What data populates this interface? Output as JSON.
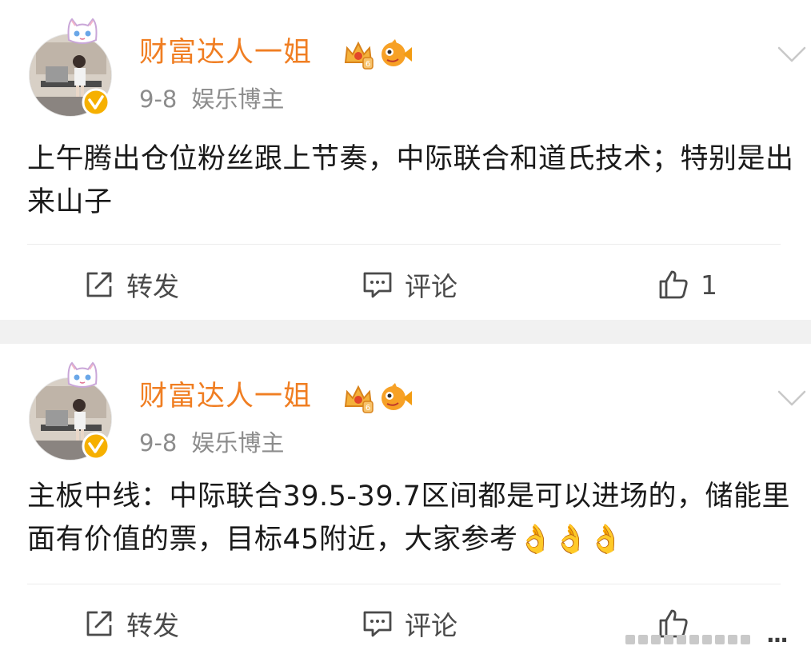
{
  "colors": {
    "username": "#f07e22",
    "meta": "#8c8c8c",
    "text": "#1a1a1a",
    "action": "#4a4a4a",
    "verified": "#f6b000",
    "separator": "#f1f1f1"
  },
  "posts": [
    {
      "author": "财富达人一姐",
      "date": "9-8",
      "source": "娱乐博主",
      "text": "上午腾出仓位粉丝跟上节奏，中际联合和道氏技术；特别是出来山子",
      "actions": {
        "repost": "转发",
        "comment": "评论",
        "like_count": "1"
      },
      "icons": [
        "cat-avatar-frame-icon",
        "verified-badge-icon",
        "crown-level-icon",
        "fish-badge-icon",
        "chevron-down-icon"
      ]
    },
    {
      "author": "财富达人一姐",
      "date": "9-8",
      "source": "娱乐博主",
      "text": "主板中线：中际联合39.5-39.7区间都是可以进场的，储能里面有价值的票，目标45附近，大家参考👌👌👌",
      "actions": {
        "repost": "转发",
        "comment": "评论",
        "like_count": ""
      },
      "icons": [
        "cat-avatar-frame-icon",
        "verified-badge-icon",
        "crown-level-icon",
        "fish-badge-icon",
        "chevron-down-icon"
      ]
    }
  ],
  "watermark": {
    "text": "..."
  }
}
